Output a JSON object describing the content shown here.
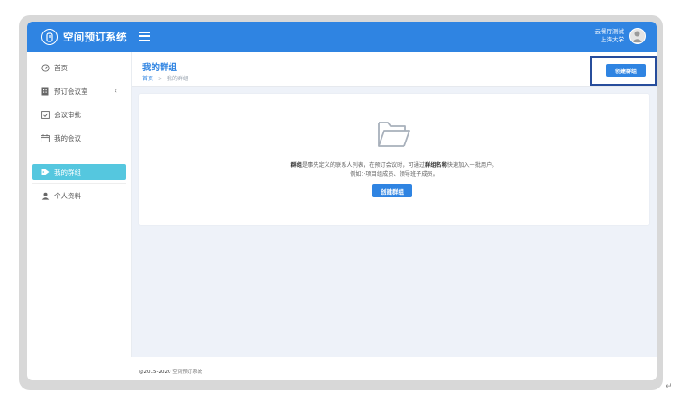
{
  "app": {
    "title": "空间预订系统"
  },
  "user": {
    "name": "云餐厅测试",
    "org": "上海大学"
  },
  "sidebar": {
    "items": [
      {
        "label": "首页",
        "icon": "dashboard-icon"
      },
      {
        "label": "预订会议室",
        "icon": "building-icon",
        "chevron": "‹"
      },
      {
        "label": "会议审批",
        "icon": "approval-icon"
      },
      {
        "label": "我的会议",
        "icon": "calendar-icon"
      },
      {
        "label": "我的群组",
        "icon": "tag-icon",
        "active": true
      },
      {
        "label": "个人资料",
        "icon": "user-icon"
      }
    ]
  },
  "page": {
    "title": "我的群组",
    "breadcrumb": {
      "home": "首页",
      "separator": ">",
      "current": "我的群组"
    },
    "header_button": "创建群组"
  },
  "empty_state": {
    "line1_bold1": "群组",
    "line1_part1": "是事先定义的联系人列表，在预订会议时，可通过",
    "line1_bold2": "群组名称",
    "line1_part2": "快速加入一批用户。",
    "line2": "例如：·项目组成员、领导班子成员。",
    "button": "创建群组"
  },
  "footer": {
    "year": "@2015-2020",
    "name": "空间预订系统"
  },
  "colors": {
    "primary": "#2f84e2",
    "active_nav": "#55c7df",
    "highlight_border": "#274d9c",
    "content_bg": "#eef2f9"
  },
  "misc": {
    "return_mark": "↵"
  }
}
